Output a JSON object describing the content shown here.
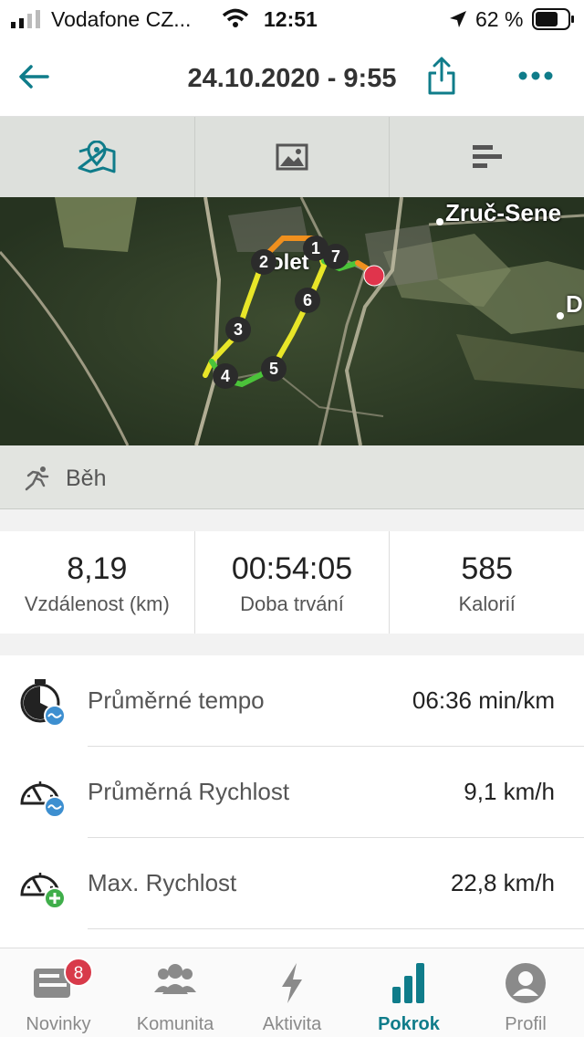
{
  "status_bar": {
    "carrier": "Vodafone CZ...",
    "time": "12:51",
    "battery": "62 %"
  },
  "header": {
    "title": "24.10.2020 - 9:55"
  },
  "map": {
    "place_labels": [
      "Zruč-Sene",
      "D",
      "olet"
    ],
    "lap_markers": [
      "1",
      "2",
      "3",
      "4",
      "5",
      "6",
      "7"
    ]
  },
  "activity": {
    "label": "Běh"
  },
  "summary": [
    {
      "value": "8,19",
      "label": "Vzdálenost (km)"
    },
    {
      "value": "00:54:05",
      "label": "Doba trvání"
    },
    {
      "value": "585",
      "label": "Kalorií"
    }
  ],
  "metrics": [
    {
      "name": "Průměrné tempo",
      "value": "06:36 min/km"
    },
    {
      "name": "Průměrná Rychlost",
      "value": "9,1 km/h"
    },
    {
      "name": "Max. Rychlost",
      "value": "22,8 km/h"
    }
  ],
  "nav": [
    {
      "label": "Novinky",
      "badge": "8"
    },
    {
      "label": "Komunita"
    },
    {
      "label": "Aktivita"
    },
    {
      "label": "Pokrok"
    },
    {
      "label": "Profil"
    }
  ],
  "colors": {
    "accent": "#0f7c8a",
    "badge": "#d83a4a",
    "route_yellow": "#e8e628",
    "route_green": "#4bc43a",
    "route_orange": "#f0901e"
  }
}
